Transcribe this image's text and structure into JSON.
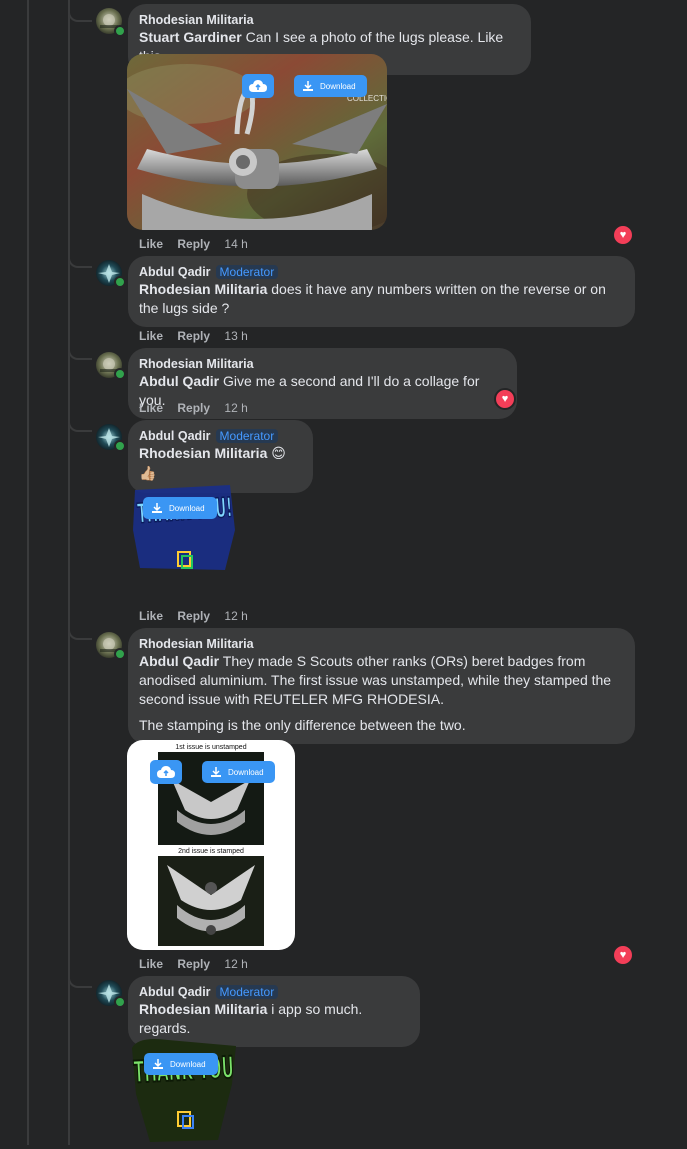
{
  "colors": {
    "background": "#242526",
    "bubble": "#3a3b3c",
    "accent": "#3a96f4",
    "moderator": "#4599ff",
    "heart": "#f33e58"
  },
  "actions": {
    "like": "Like",
    "reply": "Reply"
  },
  "download_label": "Download",
  "comments": [
    {
      "author": "Rhodesian Militaria",
      "mention": "Stuart Gardiner",
      "text": "Can I see a photo of the lugs please. Like this.",
      "image_watermark": "COLLECTION",
      "time": "14 h",
      "reaction": "heart"
    },
    {
      "author": "Abdul Qadir",
      "badge": "Moderator",
      "mention": "Rhodesian Militaria",
      "text": "does it have any numbers written on the reverse or on the lugs side ?",
      "time": "13 h"
    },
    {
      "author": "Rhodesian Militaria",
      "mention": "Abdul Qadir",
      "text": "Give me a second and I'll do a collage for you.",
      "time": "12 h",
      "reaction": "heart"
    },
    {
      "author": "Abdul Qadir",
      "badge": "Moderator",
      "mention": "Rhodesian Militaria",
      "text": "😊👍🏼",
      "sticker_text": "THANK YOU!",
      "time": "12 h"
    },
    {
      "author": "Rhodesian Militaria",
      "mention": "Abdul Qadir",
      "text": "They made S Scouts other ranks (ORs) beret badges from anodised aluminium. The first issue was unstamped, while they stamped the second issue with REUTELER MFG RHODESIA.",
      "text2": "The stamping is the only difference between the two.",
      "collage_caption1": "1st issue is unstamped",
      "collage_caption2": "2nd issue is stamped",
      "time": "12 h",
      "reaction": "heart"
    },
    {
      "author": "Abdul Qadir",
      "badge": "Moderator",
      "mention": "Rhodesian Militaria",
      "text": "i app so much. regards.",
      "sticker_text": "THANK YOU"
    }
  ]
}
